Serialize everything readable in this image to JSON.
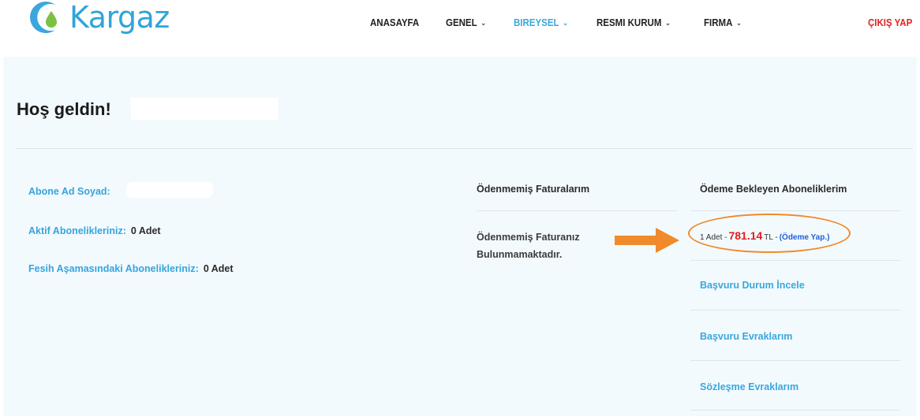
{
  "brand": {
    "name": "Kargaz",
    "logo_icon": "drop-logo-icon",
    "color": "#2fa5d8"
  },
  "nav": {
    "items": [
      {
        "label": "ANASAYFA",
        "dropdown": false
      },
      {
        "label": "GENEL",
        "dropdown": true
      },
      {
        "label": "BIREYSEL",
        "dropdown": true,
        "active": true
      },
      {
        "label": "RESMI KURUM",
        "dropdown": true
      },
      {
        "label": "FIRMA",
        "dropdown": true
      }
    ],
    "logout_label": "ÇIKIŞ YAP",
    "chevron_icon": "chevron-down-icon"
  },
  "welcome": {
    "title": "Hoş geldin!"
  },
  "profile": {
    "name_label": "Abone Ad Soyad:",
    "active_label": "Aktif Abonelikleriniz:",
    "active_value": "0 Adet",
    "termination_label": "Fesih Aşamasındaki Abonelikleriniz:",
    "termination_value": "0 Adet"
  },
  "unpaid": {
    "title": "Ödenmemiş Faturalarım",
    "message": "Ödenmemiş Faturanız Bulunmamaktadır."
  },
  "pending": {
    "title": "Ödeme Bekleyen Aboneliklerim",
    "count": "1 Adet -",
    "amount": "781.14",
    "currency": "TL -",
    "pay_label": "(Ödeme Yap.)",
    "links": [
      "Başvuru Durum İncele",
      "Başvuru Evraklarım",
      "Sözleşme Evraklarım"
    ]
  },
  "annotation": {
    "arrow_icon": "arrow-right-icon",
    "highlight_color": "#f08a2a"
  },
  "colors": {
    "accent": "#3aa7dd",
    "logout": "#e52020",
    "amount": "#e41b1b",
    "panel": "#f3fafe"
  }
}
